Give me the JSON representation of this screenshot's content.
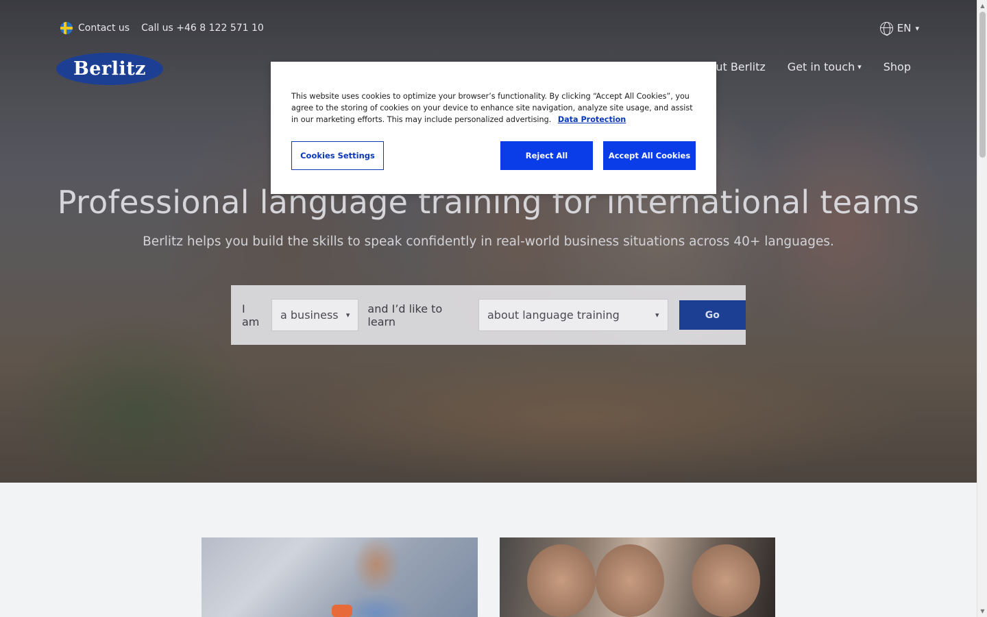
{
  "topbar": {
    "contact_label": "Contact us",
    "phone_label": "Call us +46 8 122 571 10",
    "language_label": "EN",
    "flag_icon": "sweden-flag-icon",
    "globe_icon": "globe-icon",
    "chevron_icon": "chevron-down-icon"
  },
  "logo": {
    "text": "Berlitz"
  },
  "nav": {
    "items": [
      {
        "label": "About Berlitz"
      },
      {
        "label": "Get in touch"
      },
      {
        "label": "Shop"
      }
    ]
  },
  "hero": {
    "headline": "Professional language training for international teams",
    "subheadline": "Berlitz helps you build the skills to speak confidently in real-world business situations across 40+ languages."
  },
  "finder": {
    "label_1": "I am",
    "select_1_value": "a business",
    "label_2": "and I’d like to learn",
    "select_2_value": "about language training",
    "go_label": "Go"
  },
  "cookie_modal": {
    "text": "This website uses cookies to optimize your browser’s functionality. By clicking “Accept All Cookies”, you agree to the storing of cookies on your device to enhance site navigation, analyze site usage, and assist in our marketing efforts. This may include personalized advertising.",
    "link_label": "Data Protection",
    "settings_label": "Cookies Settings",
    "reject_label": "Reject All",
    "accept_label": "Accept All Cookies"
  },
  "colors": {
    "brand_blue": "#1c3f94",
    "cookie_button_blue": "#0a3de8",
    "link_blue": "#0a38b8"
  }
}
